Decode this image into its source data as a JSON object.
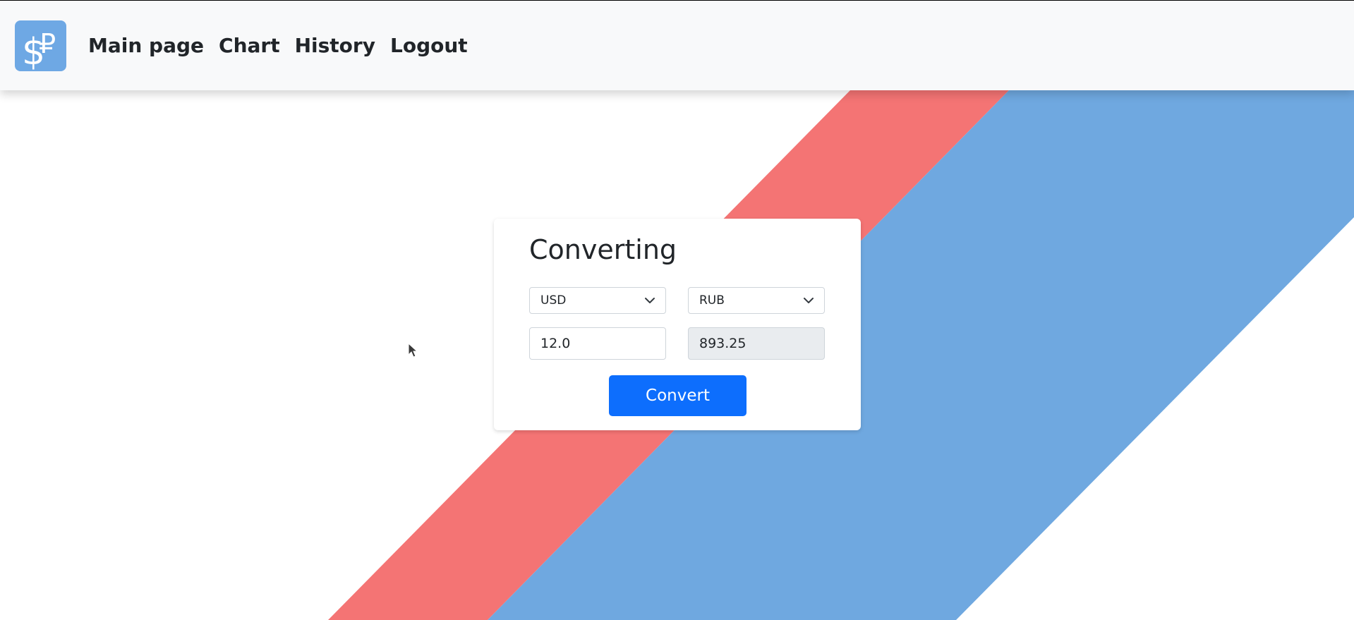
{
  "colors": {
    "stripe_red": "#f47474",
    "stripe_blue": "#6fa8e0",
    "navbar_bg": "#f8f9fa",
    "logo_bg": "#6ea8e4",
    "button_primary": "#0d6efd",
    "readonly_bg": "#e9ecef"
  },
  "navbar": {
    "logo_icon": "dollar-ruble-logo-icon",
    "links": [
      "Main page",
      "Chart",
      "History",
      "Logout"
    ]
  },
  "converter": {
    "title": "Converting",
    "from_currency": "USD",
    "to_currency": "RUB",
    "amount": "12.0",
    "result": "893.25",
    "button_label": "Convert"
  }
}
